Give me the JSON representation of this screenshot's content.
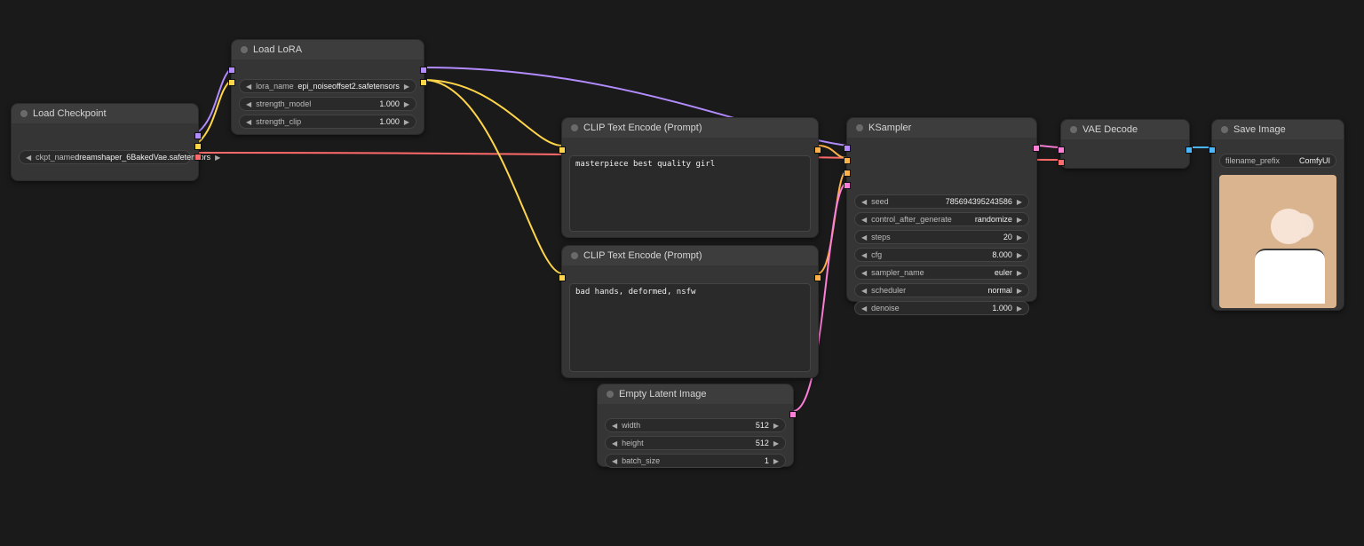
{
  "nodes": {
    "load_checkpoint": {
      "title": "Load Checkpoint",
      "ckpt_label": "ckpt_name",
      "ckpt_value": "dreamshaper_6BakedVae.safetensors"
    },
    "load_lora": {
      "title": "Load LoRA",
      "lora_label": "lora_name",
      "lora_value": "epi_noiseoffset2.safetensors",
      "strength_model_label": "strength_model",
      "strength_model_value": "1.000",
      "strength_clip_label": "strength_clip",
      "strength_clip_value": "1.000"
    },
    "clip_pos": {
      "title": "CLIP Text Encode (Prompt)",
      "text": "masterpiece best quality girl"
    },
    "clip_neg": {
      "title": "CLIP Text Encode (Prompt)",
      "text": "bad hands, deformed, nsfw"
    },
    "empty_latent": {
      "title": "Empty Latent Image",
      "width_label": "width",
      "width_value": "512",
      "height_label": "height",
      "height_value": "512",
      "batch_label": "batch_size",
      "batch_value": "1"
    },
    "ksampler": {
      "title": "KSampler",
      "seed_label": "seed",
      "seed_value": "785694395243586",
      "control_label": "control_after_generate",
      "control_value": "randomize",
      "steps_label": "steps",
      "steps_value": "20",
      "cfg_label": "cfg",
      "cfg_value": "8.000",
      "sampler_label": "sampler_name",
      "sampler_value": "euler",
      "scheduler_label": "scheduler",
      "scheduler_value": "normal",
      "denoise_label": "denoise",
      "denoise_value": "1.000"
    },
    "vae_decode": {
      "title": "VAE Decode"
    },
    "save_image": {
      "title": "Save Image",
      "prefix_label": "filename_prefix",
      "prefix_value": "ComfyUI"
    }
  }
}
